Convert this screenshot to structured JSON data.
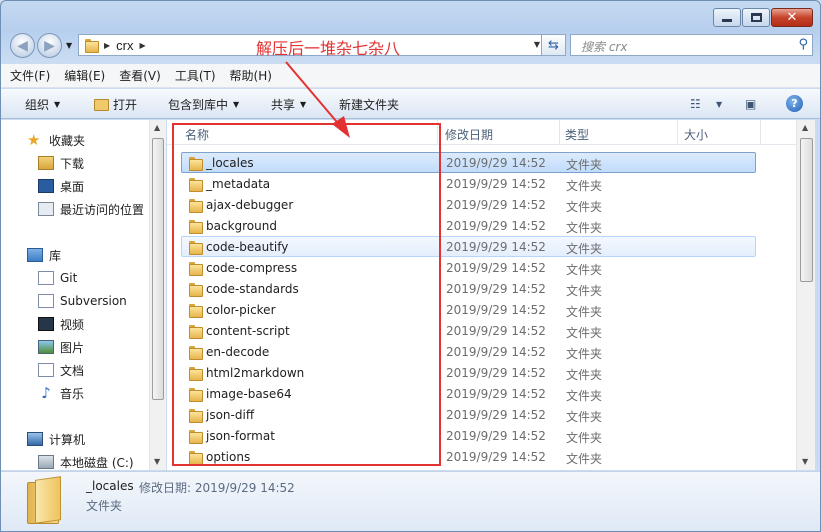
{
  "window": {
    "caption_buttons": {
      "minimize": "",
      "maximize": "",
      "close": "✕"
    }
  },
  "nav": {
    "address_crumb": "crx",
    "search_placeholder": "搜索 crx",
    "back_icon": "arrow-left-icon",
    "forward_icon": "arrow-right-icon",
    "refresh_icon": "refresh-icon",
    "search_icon": "search-icon"
  },
  "annotation": {
    "text": "解压后一堆杂七杂八",
    "color": "#e33232"
  },
  "menubar": [
    "文件(F)",
    "编辑(E)",
    "查看(V)",
    "工具(T)",
    "帮助(H)"
  ],
  "commands": {
    "organize": "组织",
    "open": "打开",
    "include_in_library": "包含到库中",
    "share": "共享",
    "new_folder": "新建文件夹",
    "help_icon": "?"
  },
  "sidebar": {
    "favorites": {
      "label": "收藏夹",
      "items": [
        "下载",
        "桌面",
        "最近访问的位置"
      ]
    },
    "libraries": {
      "label": "库",
      "items": [
        "Git",
        "Subversion",
        "视频",
        "图片",
        "文档",
        "音乐"
      ]
    },
    "computer": {
      "label": "计算机",
      "items": [
        "本地磁盘 (C:)"
      ]
    }
  },
  "columns": {
    "name": "名称",
    "date": "修改日期",
    "type": "类型",
    "size": "大小"
  },
  "files": [
    {
      "name": "_locales",
      "date": "2019/9/29 14:52",
      "type": "文件夹",
      "state": "selected"
    },
    {
      "name": "_metadata",
      "date": "2019/9/29 14:52",
      "type": "文件夹"
    },
    {
      "name": "ajax-debugger",
      "date": "2019/9/29 14:52",
      "type": "文件夹"
    },
    {
      "name": "background",
      "date": "2019/9/29 14:52",
      "type": "文件夹"
    },
    {
      "name": "code-beautify",
      "date": "2019/9/29 14:52",
      "type": "文件夹",
      "state": "hover"
    },
    {
      "name": "code-compress",
      "date": "2019/9/29 14:52",
      "type": "文件夹"
    },
    {
      "name": "code-standards",
      "date": "2019/9/29 14:52",
      "type": "文件夹"
    },
    {
      "name": "color-picker",
      "date": "2019/9/29 14:52",
      "type": "文件夹"
    },
    {
      "name": "content-script",
      "date": "2019/9/29 14:52",
      "type": "文件夹"
    },
    {
      "name": "en-decode",
      "date": "2019/9/29 14:52",
      "type": "文件夹"
    },
    {
      "name": "html2markdown",
      "date": "2019/9/29 14:52",
      "type": "文件夹"
    },
    {
      "name": "image-base64",
      "date": "2019/9/29 14:52",
      "type": "文件夹"
    },
    {
      "name": "json-diff",
      "date": "2019/9/29 14:52",
      "type": "文件夹"
    },
    {
      "name": "json-format",
      "date": "2019/9/29 14:52",
      "type": "文件夹"
    },
    {
      "name": "options",
      "date": "2019/9/29 14:52",
      "type": "文件夹"
    }
  ],
  "details": {
    "name": "_locales",
    "meta": "修改日期: 2019/9/29 14:52",
    "type": "文件夹"
  }
}
